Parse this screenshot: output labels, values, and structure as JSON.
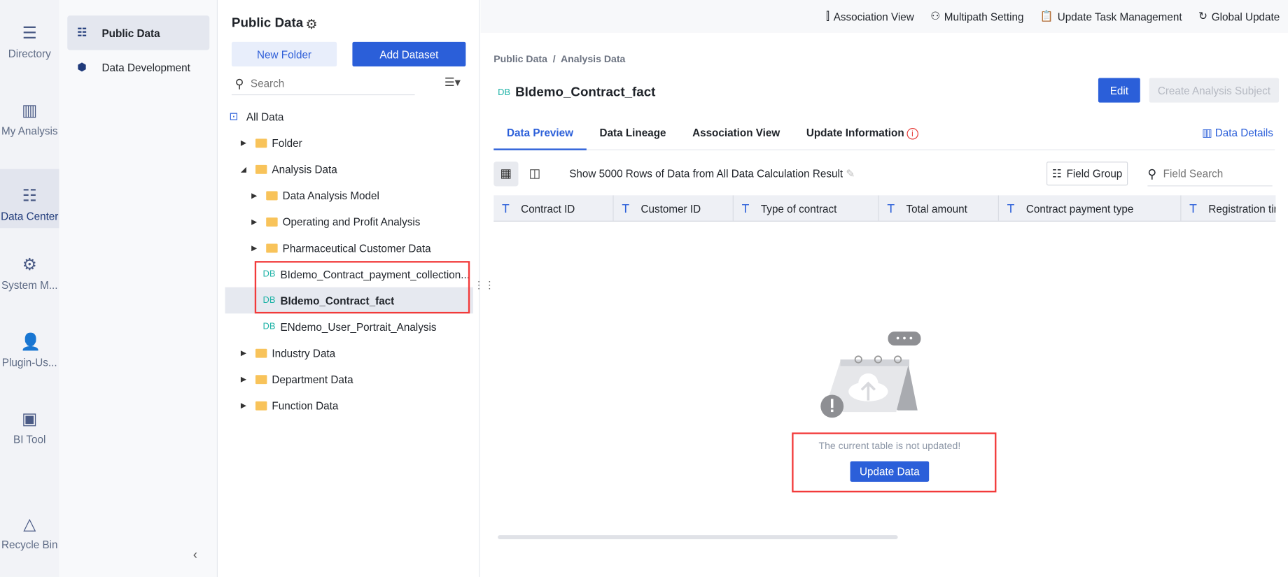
{
  "rail": [
    {
      "label": "Directory",
      "icon": "directory-icon"
    },
    {
      "label": "My Analysis",
      "icon": "chart-icon"
    },
    {
      "label": "Data Center",
      "icon": "database-icon",
      "active": true
    },
    {
      "label": "System M...",
      "icon": "gear-icon"
    },
    {
      "label": "Plugin-Us...",
      "icon": "user-icon"
    },
    {
      "label": "BI Tool",
      "icon": "toolbox-icon"
    },
    {
      "label": "Recycle Bin",
      "icon": "recycle-icon"
    }
  ],
  "side": {
    "items": [
      {
        "label": "Public Data"
      },
      {
        "label": "Data Development"
      }
    ]
  },
  "tree": {
    "title": "Public Data",
    "new_folder": "New Folder",
    "add_dataset": "Add Dataset",
    "search_placeholder": "Search",
    "nodes": [
      {
        "label": "All Data"
      },
      {
        "label": "Folder"
      },
      {
        "label": "Analysis Data"
      },
      {
        "label": "Data Analysis Model"
      },
      {
        "label": "Operating and Profit Analysis"
      },
      {
        "label": "Pharmaceutical Customer Data"
      },
      {
        "label": "BIdemo_Contract_payment_collection..."
      },
      {
        "label": "BIdemo_Contract_fact"
      },
      {
        "label": "ENdemo_User_Portrait_Analysis"
      },
      {
        "label": "Industry Data"
      },
      {
        "label": "Department Data"
      },
      {
        "label": "Function Data"
      }
    ],
    "db_badge": "DB"
  },
  "topbar": {
    "items": [
      "Association View",
      "Multipath Setting",
      "Update Task Management",
      "Global Update"
    ]
  },
  "main": {
    "breadcrumb": "Public Data  /  Analysis Data",
    "title": "BIdemo_Contract_fact",
    "edit": "Edit",
    "create_subject": "Create Analysis Subject",
    "tabs": [
      "Data Preview",
      "Data Lineage",
      "Association View",
      "Update Information"
    ],
    "data_details": "Data Details",
    "show_rows": "Show 5000 Rows of Data from All Data Calculation Result",
    "field_group": "Field Group",
    "field_search_placeholder": "Field Search",
    "columns": [
      "Contract ID",
      "Customer ID",
      "Type of contract",
      "Total amount",
      "Contract payment type",
      "Registration time"
    ],
    "empty_message": "The current table is not updated!",
    "update_data": "Update Data"
  },
  "colors": {
    "accent": "#2b5fd9",
    "highlight": "#f23a3a"
  }
}
